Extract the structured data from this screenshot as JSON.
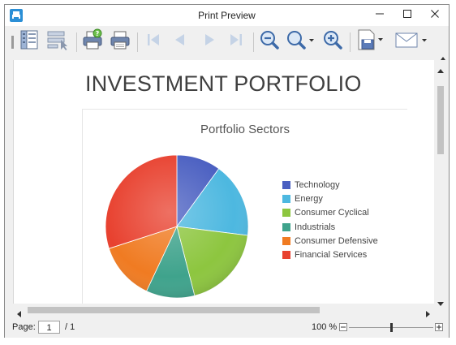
{
  "window": {
    "title": "Print Preview"
  },
  "icons": {
    "app": "print-preview-app-icon",
    "minimize": "minimize-icon",
    "maximize": "maximize-icon",
    "close": "close-icon"
  },
  "toolbar": {
    "buttons": [
      "document-map",
      "parameters",
      "print",
      "quick-print",
      "first-page",
      "previous-page",
      "next-page",
      "last-page",
      "zoom-out",
      "zoom",
      "zoom-in",
      "export",
      "send"
    ]
  },
  "document": {
    "title": "INVESTMENT PORTFOLIO"
  },
  "chart_data": {
    "type": "pie",
    "title": "Portfolio Sectors",
    "legend_position": "right",
    "series": [
      {
        "name": "Technology",
        "value": 10,
        "color": "#4a5fc1"
      },
      {
        "name": "Energy",
        "value": 17,
        "color": "#4db8e0"
      },
      {
        "name": "Consumer Cyclical",
        "value": 19,
        "color": "#8dc63f"
      },
      {
        "name": "Industrials",
        "value": 11,
        "color": "#3fa38c"
      },
      {
        "name": "Consumer Defensive",
        "value": 13,
        "color": "#f07b22"
      },
      {
        "name": "Financial Services",
        "value": 30,
        "color": "#e8412f"
      }
    ]
  },
  "status": {
    "page_label": "Page:",
    "page_value": "1",
    "page_total": "/ 1",
    "zoom": "100 %",
    "zoom_level": 0.5
  }
}
